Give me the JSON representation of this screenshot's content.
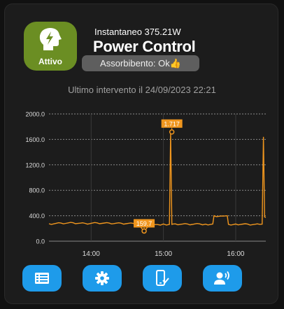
{
  "header": {
    "subtitle": "Instantaneo 375.21W",
    "title": "Power Control",
    "status_pill": "Assorbibento: Ok👍",
    "icon_status": "Attivo",
    "icon_color": "#6b8e23"
  },
  "last_intervention": "Ultimo intervento il 24/09/2023 22:21",
  "chart_data": {
    "type": "line",
    "line_color": "#f0961e",
    "yticks": [
      "0.0",
      "400.0",
      "800.0",
      "1200.0",
      "1600.0",
      "2000.0"
    ],
    "ylim": [
      0,
      2000
    ],
    "xticks": [
      "14:00",
      "15:00",
      "16:00"
    ],
    "xlim": [
      "13:25",
      "16:25"
    ],
    "grid": true,
    "annotations": [
      {
        "label": "1.717",
        "x": "15:07",
        "y": 1717
      },
      {
        "label": "159.7",
        "x": "14:44",
        "y": 160
      }
    ],
    "series": [
      {
        "x": [
          "13:25",
          "13:35",
          "13:45",
          "13:55",
          "14:05",
          "14:15",
          "14:25",
          "14:35",
          "14:40",
          "14:42",
          "14:44",
          "14:46",
          "14:48",
          "14:55",
          "15:00",
          "15:05",
          "15:06",
          "15:07",
          "15:08",
          "15:10",
          "15:20",
          "15:30",
          "15:35",
          "15:41",
          "15:42",
          "15:50",
          "15:53",
          "15:54",
          "16:00",
          "16:10",
          "16:20",
          "16:22",
          "16:23",
          "16:24",
          "16:25"
        ],
        "y": [
          275,
          285,
          290,
          280,
          288,
          285,
          282,
          280,
          262,
          200,
          160,
          200,
          262,
          262,
          270,
          265,
          1717,
          265,
          270,
          272,
          270,
          272,
          268,
          270,
          400,
          395,
          400,
          265,
          270,
          268,
          265,
          268,
          1640,
          380,
          375
        ]
      }
    ]
  },
  "buttons": [
    {
      "label": "table-list",
      "color": "#1e9bea"
    },
    {
      "label": "settings",
      "color": "#1e9bea"
    },
    {
      "label": "phone-check",
      "color": "#1e9bea"
    },
    {
      "label": "voice-user",
      "color": "#1e9bea"
    }
  ]
}
